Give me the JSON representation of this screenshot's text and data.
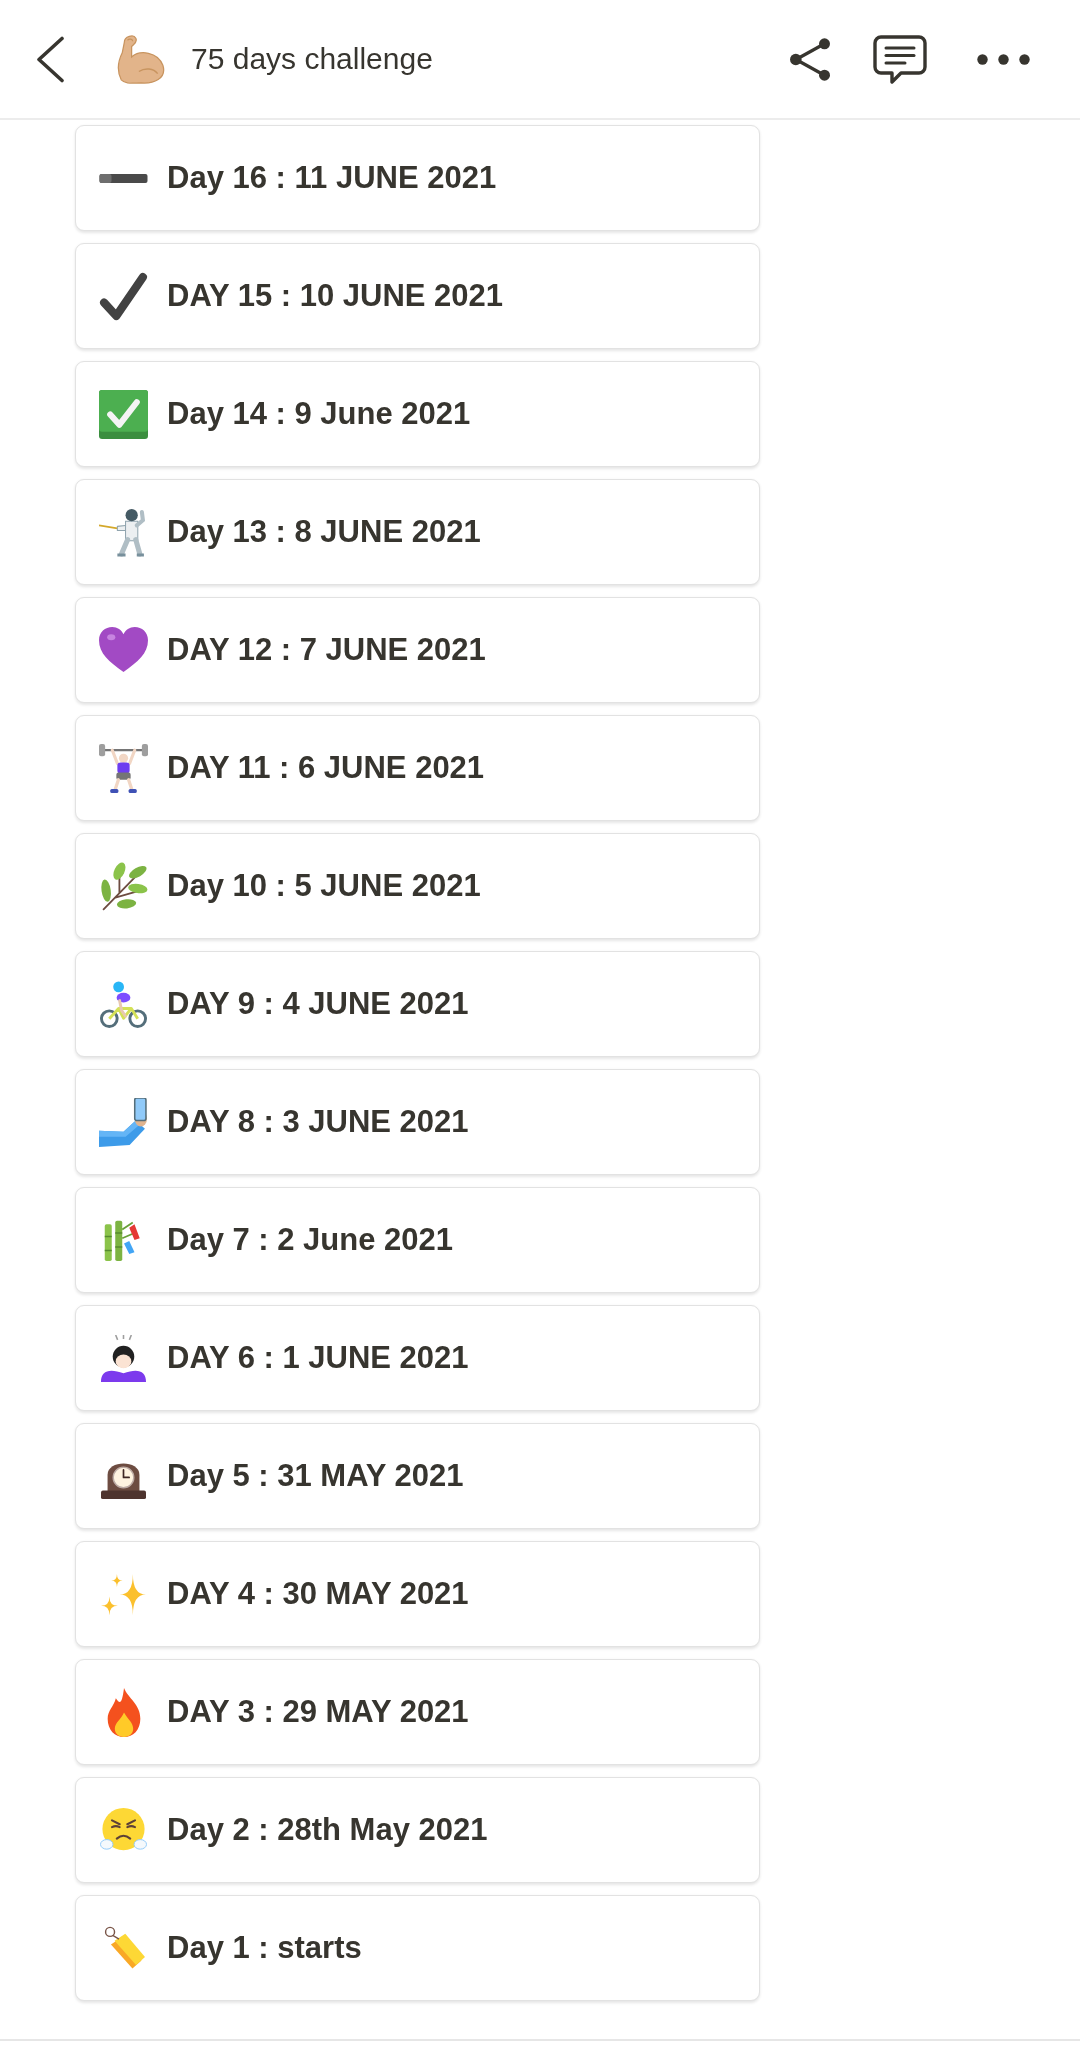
{
  "header": {
    "title": "75 days challenge"
  },
  "pages": [
    {
      "kind": "dash",
      "title": "Day 16 : 11 JUNE 2021"
    },
    {
      "kind": "check",
      "title": "DAY 15 : 10 JUNE 2021"
    },
    {
      "kind": "checkbox",
      "title": "Day 14 : 9 June 2021"
    },
    {
      "kind": "fencer",
      "title": "Day 13 : 8 JUNE 2021"
    },
    {
      "kind": "heart",
      "title": "DAY 12 : 7 JUNE 2021"
    },
    {
      "kind": "lifter",
      "title": "DAY 11 : 6 JUNE 2021"
    },
    {
      "kind": "herb",
      "title": "Day 10 : 5 JUNE 2021"
    },
    {
      "kind": "cyclist",
      "title": "DAY 9 : 4 JUNE 2021"
    },
    {
      "kind": "selfie",
      "title": "DAY 8 : 3 JUNE 2021"
    },
    {
      "kind": "tanabata",
      "title": "Day 7 : 2 June 2021"
    },
    {
      "kind": "bowing",
      "title": "DAY 6 : 1 JUNE 2021"
    },
    {
      "kind": "clock",
      "title": "Day 5 : 31 MAY 2021"
    },
    {
      "kind": "sparkles",
      "title": "DAY 4 : 30 MAY 2021"
    },
    {
      "kind": "fire",
      "title": "DAY 3 : 29 MAY 2021"
    },
    {
      "kind": "steam",
      "title": "Day 2 : 28th May 2021"
    },
    {
      "kind": "tag",
      "title": "Day 1 : starts"
    }
  ]
}
